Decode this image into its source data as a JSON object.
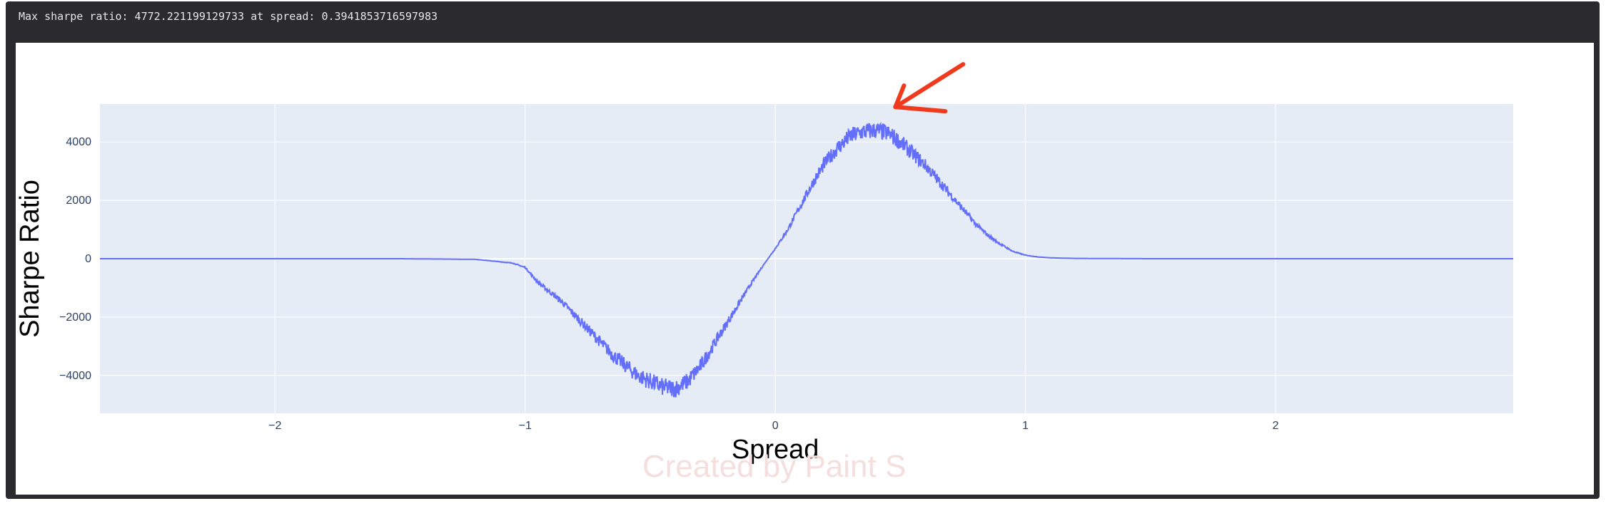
{
  "output_text": "Max sharpe ratio: 4772.221199129733 at spread: 0.3941853716597983",
  "watermark_text": "Created by Paint S",
  "colors": {
    "plot_bg": "#e5ecf6",
    "line": "#636efa",
    "grid": "#ffffff",
    "annotation_arrow": "#f03a1e",
    "output_bg": "#2b2b2f"
  },
  "chart_data": {
    "type": "line",
    "title": "",
    "xlabel": "Spread",
    "ylabel": "Sharpe Ratio",
    "xlim": [
      -2.7,
      2.95
    ],
    "ylim": [
      -5300,
      5300
    ],
    "x_ticks": [
      -2,
      -1,
      0,
      1,
      2
    ],
    "x_tick_labels": [
      "−2",
      "−1",
      "0",
      "1",
      "2"
    ],
    "y_ticks": [
      -4000,
      -2000,
      0,
      2000,
      4000
    ],
    "y_tick_labels": [
      "−4000",
      "−2000",
      "0",
      "2000",
      "4000"
    ],
    "grid": true,
    "legend": "none",
    "annotation": "red arrow pointing at peak",
    "series": [
      {
        "x": [
          -2.7,
          -2.0,
          -1.5,
          -1.2,
          -1.05,
          -1.0,
          -0.95,
          -0.85,
          -0.75,
          -0.65,
          -0.55,
          -0.45,
          -0.4,
          -0.35,
          -0.3,
          -0.25,
          -0.2,
          -0.15,
          -0.1,
          -0.05,
          0.0,
          0.05,
          0.1,
          0.15,
          0.2,
          0.25,
          0.3,
          0.35,
          0.4,
          0.45,
          0.5,
          0.55,
          0.6,
          0.65,
          0.7,
          0.75,
          0.8,
          0.85,
          0.9,
          0.95,
          1.0,
          1.05,
          1.1,
          1.2,
          1.5,
          2.0,
          2.95
        ],
        "y": [
          0,
          0,
          0,
          -20,
          -150,
          -300,
          -800,
          -1500,
          -2400,
          -3300,
          -4000,
          -4400,
          -4450,
          -4200,
          -3700,
          -3000,
          -2300,
          -1600,
          -900,
          -250,
          350,
          1000,
          1800,
          2600,
          3300,
          3800,
          4200,
          4350,
          4400,
          4300,
          4000,
          3600,
          3200,
          2700,
          2200,
          1700,
          1200,
          800,
          500,
          250,
          120,
          60,
          30,
          10,
          0,
          0,
          0
        ]
      }
    ]
  }
}
